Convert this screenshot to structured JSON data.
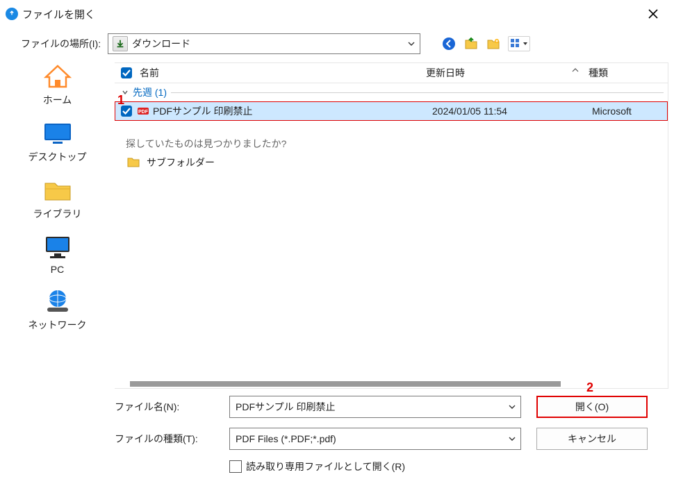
{
  "titlebar": {
    "title": "ファイルを開く"
  },
  "location": {
    "label": "ファイルの場所(I):",
    "current": "ダウンロード"
  },
  "sidebar": {
    "items": [
      {
        "label": "ホーム"
      },
      {
        "label": "デスクトップ"
      },
      {
        "label": "ライブラリ"
      },
      {
        "label": "PC"
      },
      {
        "label": "ネットワーク"
      }
    ]
  },
  "columns": {
    "name": "名前",
    "date": "更新日時",
    "type": "種類"
  },
  "group": {
    "label": "先週 (1)"
  },
  "files": [
    {
      "name": "PDFサンプル 印刷禁止",
      "date": "2024/01/05 11:54",
      "type": "Microsoft",
      "icon_label": "PDF"
    }
  ],
  "search_hint": "探していたものは見つかりましたか?",
  "subfolder": {
    "label": "サブフォルダー"
  },
  "bottom": {
    "filename_label": "ファイル名(N):",
    "filename_value": "PDFサンプル 印刷禁止",
    "filetype_label": "ファイルの種類(T):",
    "filetype_value": "PDF Files (*.PDF;*.pdf)",
    "open_btn": "開く(O)",
    "cancel_btn": "キャンセル",
    "readonly_label": "読み取り専用ファイルとして開く(R)"
  },
  "annotations": {
    "one": "1",
    "two": "2"
  }
}
